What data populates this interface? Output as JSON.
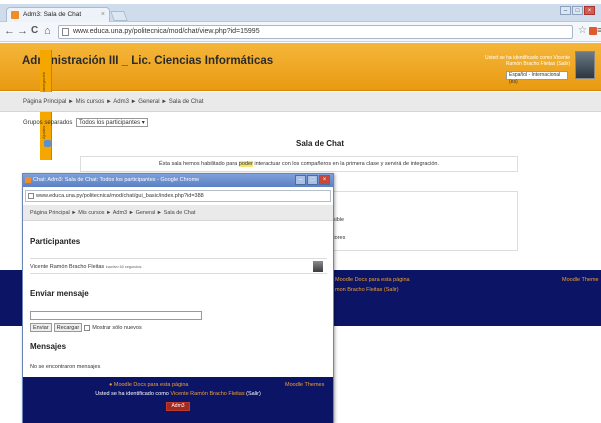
{
  "browser": {
    "tab_title": "Adm3: Sala de Chat",
    "tab_close": "×",
    "url": "www.educa.una.py/politecnica/mod/chat/view.php?id=15995",
    "back": "←",
    "forward": "→",
    "reload": "C",
    "home": "⌂",
    "star": "☆",
    "menu": "≡"
  },
  "page": {
    "course_title": "Administración III _ Lic. Ciencias Informáticas",
    "logged_in": "Usted se ha identificado como Vicente Ramón Bracho Fleitas (Salir)",
    "language": "Español - Internacional (es)",
    "dock_items": [
      "Navegación",
      "Ajustes"
    ],
    "breadcrumb": "Página Principal ► Mis cursos ► Adm3 ► General ► Sala de Chat",
    "groups_label": "Grupos separados",
    "groups_value": "Todos los participantes",
    "chat_title": "Sala de Chat",
    "intro_before": "Ésta sala hemos habilitado para ",
    "intro_mark": "poder",
    "intro_after": " interactuar con los compañeros en la primera clase y servirá de integración.",
    "side_lines": [
      "o",
      "cesible",
      "teriores"
    ],
    "footer_left": "Moodle Docs para esta página",
    "footer_right": "Moodle Theme",
    "footer_user": "mon Bracho Fleitas (Salir)"
  },
  "popup": {
    "title": "Chat: Adm3: Sala de Chat: Todos los participantes - Google Chrome",
    "url": "www.educa.una.py/politecnica/mod/chat/gui_basic/index.php?id=388",
    "breadcrumb": "Página Principal ► Mis cursos ► Adm3 ► General ► Sala de Chat",
    "participants_heading": "Participantes",
    "participant_name": "Vicente Ramón Bracho Fleitas",
    "participant_idle": "inactivo 60 segundos",
    "send_heading": "Enviar mensaje",
    "send_button": "Enviar",
    "reload_button": "Recargar",
    "only_new_label": "Mostrar sólo nuevos",
    "messages_heading": "Mensajes",
    "no_messages": "No se encontraron mensajes",
    "footer_docs": "Moodle Docs para esta página",
    "footer_themes": "Moodle Themes",
    "footer_user_prefix": "Usted se ha identificado como ",
    "footer_user_name": "Vicente Ramón Bracho Fleitas",
    "footer_user_suffix": " (Salir)",
    "footer_course_button": "Adm3"
  }
}
